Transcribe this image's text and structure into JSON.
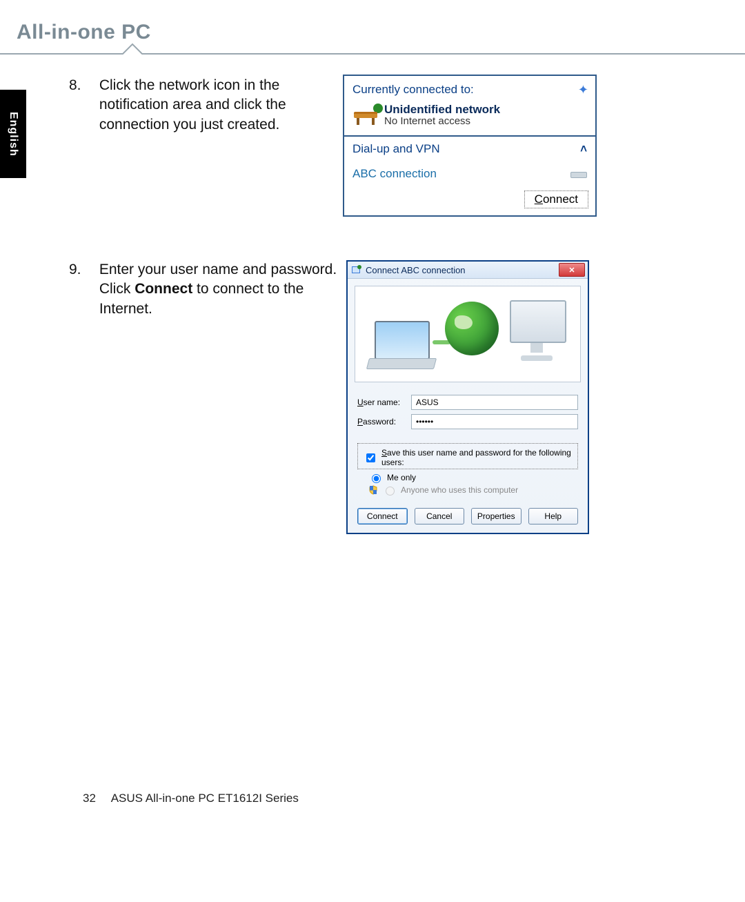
{
  "header": {
    "product_label": "All-in-one PC"
  },
  "language_tab": "English",
  "steps": {
    "s8": {
      "num": "8.",
      "text": "Click the network icon in the notification area and click the connection you just created."
    },
    "s9": {
      "num": "9.",
      "text_pre": "Enter your user name and password. Click ",
      "bold": "Connect",
      "text_post": " to connect to the Internet."
    }
  },
  "flyout": {
    "title": "Currently connected to:",
    "network_name": "Unidentified network",
    "network_status": "No Internet access",
    "section_label": "Dial-up and VPN",
    "item_label": "ABC connection",
    "connect_label_u": "C",
    "connect_label_rest": "onnect"
  },
  "dialog": {
    "title": "Connect ABC connection",
    "labels": {
      "username_u": "U",
      "username_rest": "ser name:",
      "password_u": "P",
      "password_rest": "assword:"
    },
    "fields": {
      "username": "ASUS",
      "password": "••••••"
    },
    "save_check_u": "S",
    "save_check_rest": "ave this user name and password for the following users:",
    "radios": {
      "me_u": "n",
      "me_pre": "Me o",
      "me_post": "ly",
      "anyone_u": "A",
      "anyone_rest": "nyone who uses this computer"
    },
    "buttons": {
      "connect_u": "C",
      "connect_rest": "onnect",
      "cancel": "Cancel",
      "properties_u": "o",
      "properties_pre": "Pr",
      "properties_post": "perties",
      "help_u": "H",
      "help_rest": "elp"
    }
  },
  "footer": {
    "page_number": "32",
    "product_line": "ASUS All-in-one PC ET1612I Series"
  }
}
